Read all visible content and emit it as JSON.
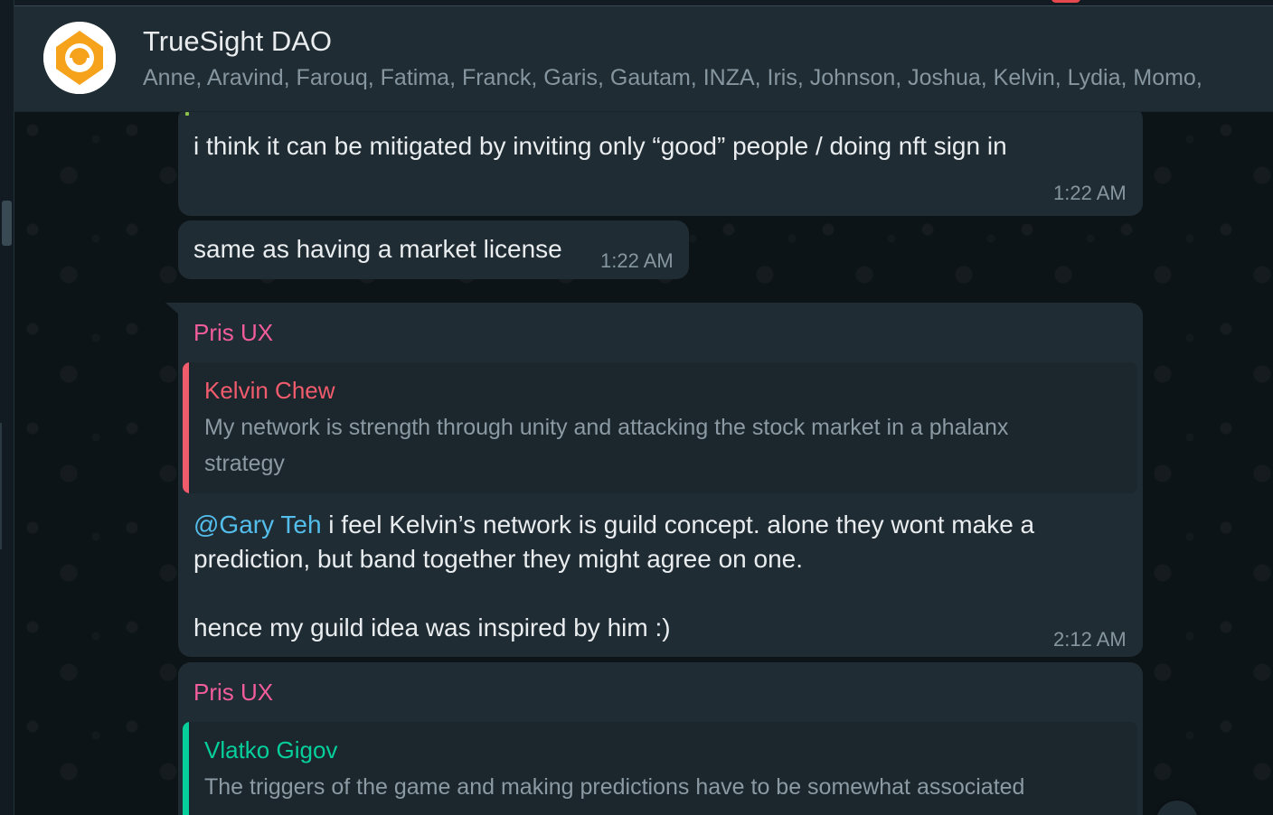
{
  "chat": {
    "title": "TrueSight DAO",
    "members": "Anne, Aravind, Farouq, Fatima, Franck, Garis, Gautam, INZA, Iris, Johnson, Joshua, Kelvin, Lydia, Momo,"
  },
  "colors": {
    "header_bg": "#202c33",
    "bubble_bg": "#202c33",
    "chat_bg": "#0d1418",
    "sender_pink": "#f15c9c",
    "quote_red": "#f15c6d",
    "quote_green": "#06cf9c",
    "mention_blue": "#53bdeb",
    "avatar_orange": "#f7a21b"
  },
  "messages": [
    {
      "text": "i think it can be mitigated by inviting only “good” people / doing nft sign in",
      "time": "1:22 AM"
    },
    {
      "text": "same as having a market license",
      "time": "1:22 AM"
    },
    {
      "sender": "Pris UX",
      "quote_author": "Kelvin Chew",
      "quote_line1": "My network is strength through unity and attacking the stock market in a phalanx",
      "quote_line2": "strategy",
      "mention": "@Gary Teh",
      "line1_rest": " i feel Kelvin’s network is guild concept. alone they wont make a",
      "line2": "prediction, but band together they might agree on one.",
      "line3": "hence my guild idea was inspired by him :)",
      "time": "2:12 AM"
    },
    {
      "sender": "Pris UX",
      "quote_author": "Vlatko Gigov",
      "quote_line1": "The triggers of the game and making predictions have to be somewhat associated"
    }
  ],
  "icons": {
    "avatar": "truesight-logo-icon",
    "scroll": "scroll-down-icon"
  }
}
